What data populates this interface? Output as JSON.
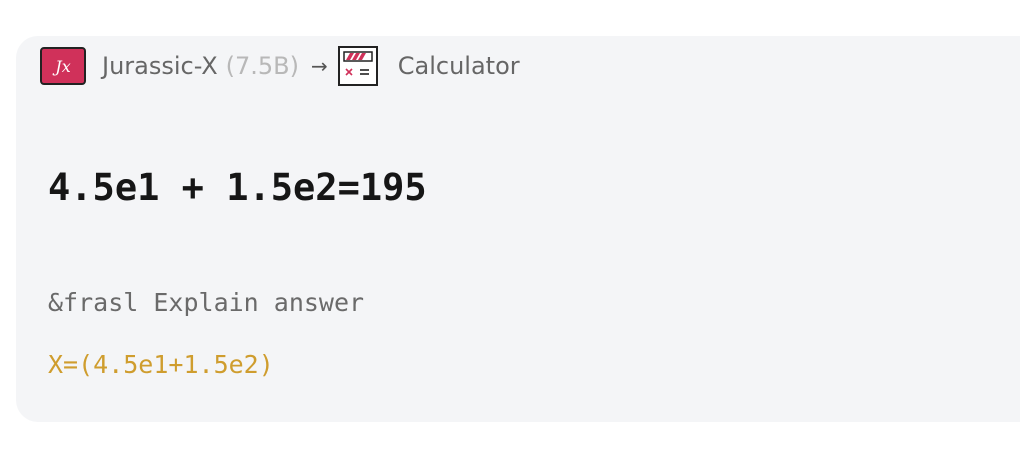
{
  "header": {
    "model_logo_text": "Jx",
    "model_name": "Jurassic-X",
    "model_size": "(7.5B)",
    "arrow": "→",
    "tool_icon": "calculator-icon",
    "tool_name": "Calculator"
  },
  "result": {
    "equation": "4.5e1 + 1.5e2=195"
  },
  "explanation": {
    "label": "&frasl Explain answer",
    "expression": "X=(4.5e1+1.5e2)"
  },
  "colors": {
    "card_background": "#f4f5f7",
    "logo_background": "#d0315a",
    "expression_color": "#cf9d2e",
    "calculator_accent": "#d0315a"
  }
}
